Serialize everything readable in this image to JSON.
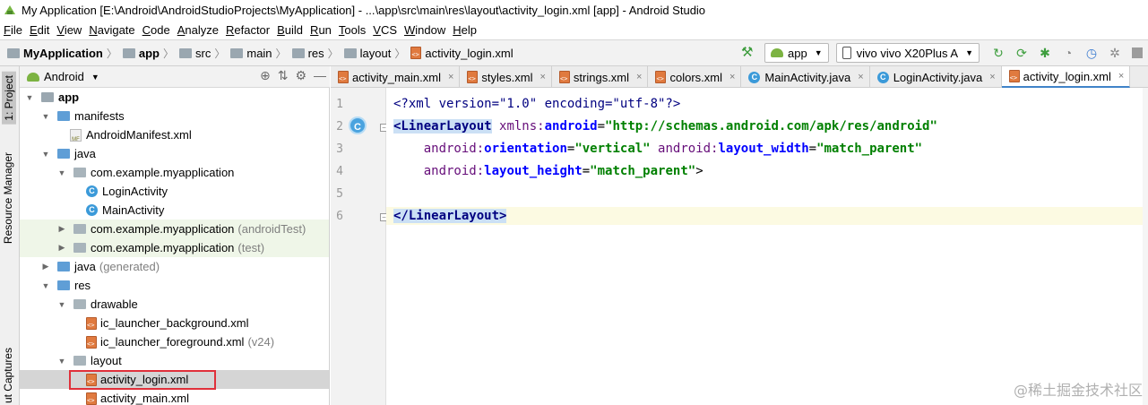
{
  "window": {
    "title": "My Application [E:\\Android\\AndroidStudioProjects\\MyApplication] - ...\\app\\src\\main\\res\\layout\\activity_login.xml [app] - Android Studio"
  },
  "menu": [
    "File",
    "Edit",
    "View",
    "Navigate",
    "Code",
    "Analyze",
    "Refactor",
    "Build",
    "Run",
    "Tools",
    "VCS",
    "Window",
    "Help"
  ],
  "breadcrumb": [
    "MyApplication",
    "app",
    "src",
    "main",
    "res",
    "layout",
    "activity_login.xml"
  ],
  "toolbar": {
    "run_config": "app",
    "device": "vivo vivo X20Plus A"
  },
  "side_tabs": {
    "project": "1: Project",
    "resource_manager": "Resource Manager",
    "layout_captures": "ut Captures"
  },
  "project_panel": {
    "view_mode": "Android"
  },
  "tree": [
    {
      "label": "app",
      "bold": true
    },
    {
      "label": "manifests"
    },
    {
      "label": "AndroidManifest.xml",
      "badge": "MF"
    },
    {
      "label": "java"
    },
    {
      "label": "com.example.myapplication"
    },
    {
      "label": "LoginActivity",
      "badge": "C"
    },
    {
      "label": "MainActivity",
      "badge": "C"
    },
    {
      "label": "com.example.myapplication",
      "suffix": "(androidTest)"
    },
    {
      "label": "com.example.myapplication",
      "suffix": "(test)"
    },
    {
      "label": "java",
      "suffix": "(generated)"
    },
    {
      "label": "res"
    },
    {
      "label": "drawable"
    },
    {
      "label": "ic_launcher_background.xml"
    },
    {
      "label": "ic_launcher_foreground.xml",
      "suffix": "(v24)"
    },
    {
      "label": "layout"
    },
    {
      "label": "activity_login.xml"
    },
    {
      "label": "activity_main.xml"
    }
  ],
  "tabs": [
    {
      "label": "activity_main.xml"
    },
    {
      "label": "styles.xml"
    },
    {
      "label": "strings.xml"
    },
    {
      "label": "colors.xml"
    },
    {
      "label": "MainActivity.java"
    },
    {
      "label": "LoginActivity.java"
    },
    {
      "label": "activity_login.xml"
    }
  ],
  "editor": {
    "line_numbers": [
      "1",
      "2",
      "3",
      "4",
      "5",
      "6"
    ],
    "gutter_badge": "C",
    "code": {
      "l1": "<?xml version=\"1.0\" encoding=\"utf-8\"?>",
      "l2_tag": "<LinearLayout",
      "l2_attr_ns": "xmlns:",
      "l2_attr_name": "android",
      "l2_eq": "=",
      "l2_val": "\"http://schemas.android.com/apk/res/android\"",
      "l3_a1": "android:",
      "l3_a1n": "orientation",
      "l3_v1": "\"vertical\"",
      "l3_a2": "android:",
      "l3_a2n": "layout_width",
      "l3_v2": "\"match_parent\"",
      "l4_a1": "android:",
      "l4_a1n": "layout_height",
      "l4_v1": "\"match_parent\"",
      "l4_end": ">",
      "l6": "</LinearLayout>"
    }
  },
  "watermark": "@稀土掘金技术社区"
}
